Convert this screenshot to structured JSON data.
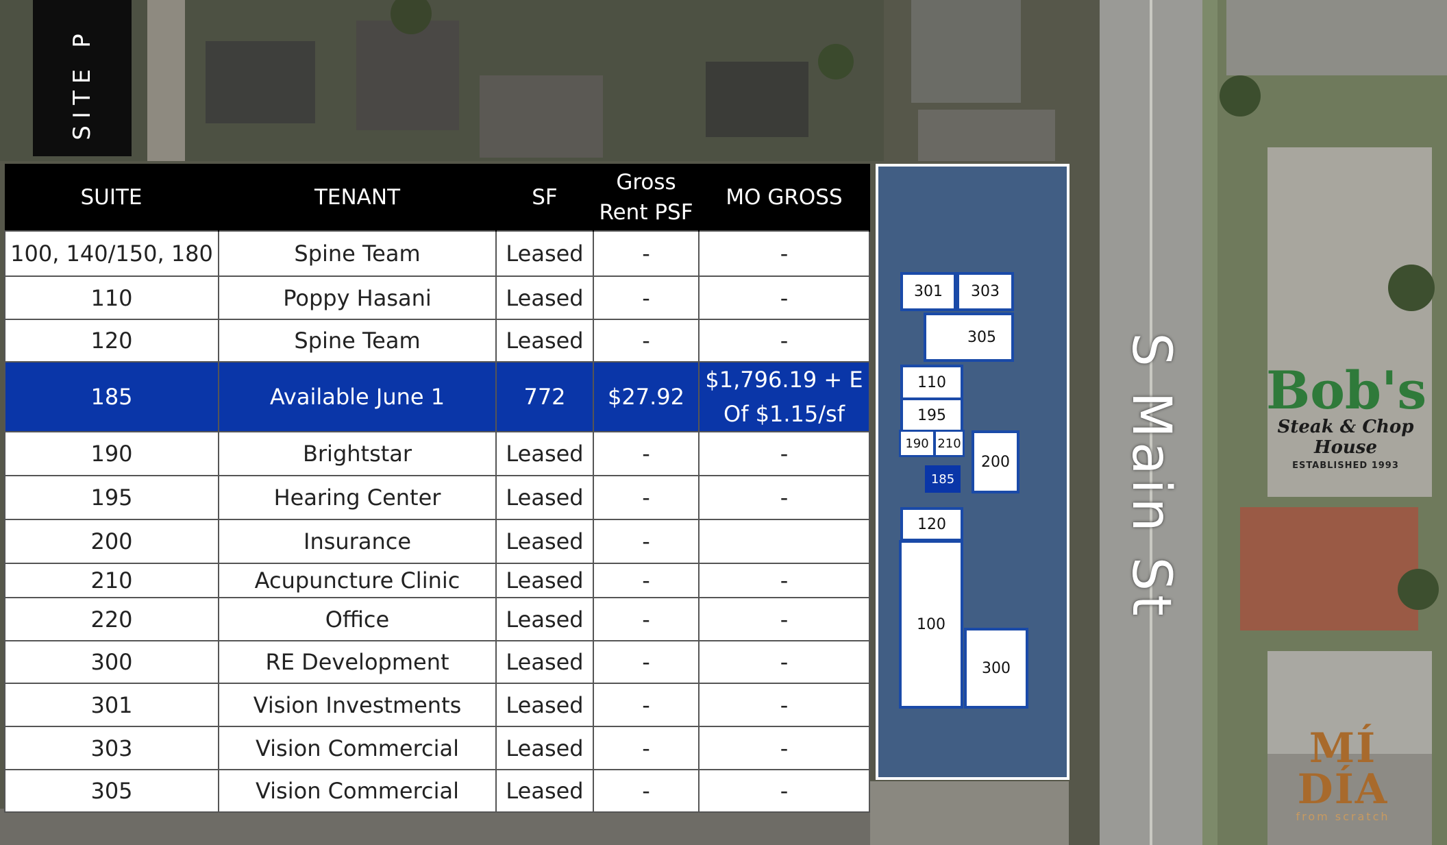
{
  "page": {
    "side_title": "SITE P"
  },
  "table": {
    "headers": [
      "SUITE",
      "TENANT",
      "SF",
      "Gross Rent PSF",
      "MO GROSS"
    ],
    "header_lines": {
      "suite": "SUITE",
      "tenant": "TENANT",
      "sf": "SF",
      "gross_l1": "Gross",
      "gross_l2": "Rent PSF",
      "mo_gross": "MO GROSS"
    },
    "rows": [
      {
        "suite": "100, 140/150, 180",
        "tenant": "Spine Team",
        "sf": "Leased",
        "gross": "-",
        "mo_gross": "-"
      },
      {
        "suite": "110",
        "tenant": "Poppy Hasani",
        "sf": "Leased",
        "gross": "-",
        "mo_gross": "-"
      },
      {
        "suite": "120",
        "tenant": "Spine Team",
        "sf": "Leased",
        "gross": "-",
        "mo_gross": "-"
      },
      {
        "suite": "185",
        "tenant": "Available June 1",
        "sf": "772",
        "gross": "$27.92",
        "mo_gross_l1": "$1,796.19 + E",
        "mo_gross_l2": "Of $1.15/sf",
        "highlight": true
      },
      {
        "suite": "190",
        "tenant": "Brightstar",
        "sf": "Leased",
        "gross": "-",
        "mo_gross": "-"
      },
      {
        "suite": "195",
        "tenant": "Hearing Center",
        "sf": "Leased",
        "gross": "-",
        "mo_gross": "-"
      },
      {
        "suite": "200",
        "tenant": "Insurance",
        "sf": "Leased",
        "gross": "-",
        "mo_gross": ""
      },
      {
        "suite": "210",
        "tenant": "Acupuncture Clinic",
        "sf": "Leased",
        "gross": "-",
        "mo_gross": "-"
      },
      {
        "suite": "220",
        "tenant": "Office",
        "sf": "Leased",
        "gross": "-",
        "mo_gross": "-"
      },
      {
        "suite": "300",
        "tenant": "RE Development",
        "sf": "Leased",
        "gross": "-",
        "mo_gross": "-"
      },
      {
        "suite": "301",
        "tenant": "Vision Investments",
        "sf": "Leased",
        "gross": "-",
        "mo_gross": "-"
      },
      {
        "suite": "303",
        "tenant": "Vision Commercial",
        "sf": "Leased",
        "gross": "-",
        "mo_gross": "-"
      },
      {
        "suite": "305",
        "tenant": "Vision Commercial",
        "sf": "Leased",
        "gross": "-",
        "mo_gross": "-"
      }
    ]
  },
  "site_plan": {
    "suites": {
      "s301": "301",
      "s303": "303",
      "s305": "305",
      "s110": "110",
      "s195": "195",
      "s190": "190",
      "s210": "210",
      "s200": "200",
      "s185": "185",
      "s120": "120",
      "s100": "100",
      "s300": "300"
    },
    "available_suite": "185",
    "street": "S Main St"
  },
  "landmarks": {
    "bobs": {
      "name": "Bob's",
      "subtitle": "Steak & Chop House",
      "established": "ESTABLISHED 1993"
    },
    "midia": {
      "name": "MÍ DÍA",
      "subtitle": "from scratch"
    }
  },
  "colors": {
    "highlight": "#0a36a8",
    "header": "#000000",
    "site_overlay": "#3264b4",
    "bobs_green": "#2f7a3a",
    "midia_brown": "#a86a2c"
  }
}
